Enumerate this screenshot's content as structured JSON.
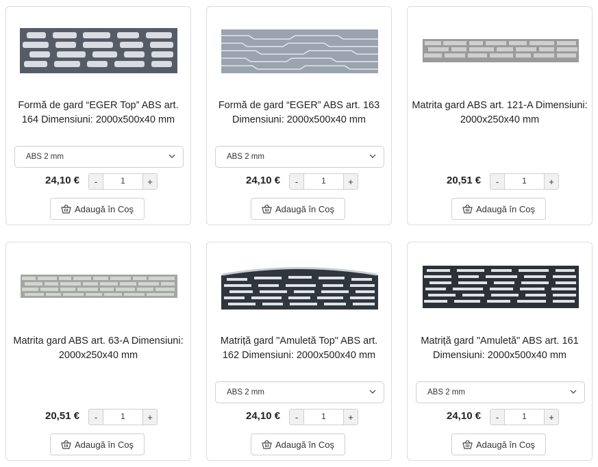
{
  "products": [
    {
      "title": "Formă de gard “EGER Top” ABS art. 164 Dimensiuni: 2000x500x40 mm",
      "variant": "ABS 2 mm",
      "price": "24,10 €",
      "qty": "1",
      "cart_label": "Adaugă în Coş",
      "image": "fence-mold-eger-top"
    },
    {
      "title": "Formă de gard “EGER” ABS art. 163 Dimensiuni: 2000x500x40 mm",
      "variant": "ABS 2 mm",
      "price": "24,10 €",
      "qty": "1",
      "cart_label": "Adaugă în Coş",
      "image": "fence-mold-eger"
    },
    {
      "title": "Matrita gard ABS art. 121-A Dimensiuni: 2000x250x40 mm",
      "variant": "",
      "price": "20,51 €",
      "qty": "1",
      "cart_label": "Adaugă în Coş",
      "image": "fence-mold-stone-121a"
    },
    {
      "title": "Matrita gard ABS art. 63-A Dimensiuni: 2000x250x40 mm",
      "variant": "",
      "price": "20,51 €",
      "qty": "1",
      "cart_label": "Adaugă în Coş",
      "image": "fence-mold-stone-63a"
    },
    {
      "title": "Matriță gard \"Amuletă Top\" ABS art. 162 Dimensiuni: 2000x500x40 mm",
      "variant": "ABS 2 mm",
      "price": "24,10 €",
      "qty": "1",
      "cart_label": "Adaugă în Coş",
      "image": "fence-mold-amuleta-top"
    },
    {
      "title": "Matriță gard \"Amuletă\" ABS art. 161 Dimensiuni: 2000x500x40 mm",
      "variant": "ABS 2 mm",
      "price": "24,10 €",
      "qty": "1",
      "cart_label": "Adaugă în Coş",
      "image": "fence-mold-amuleta"
    }
  ],
  "qty_minus": "-",
  "qty_plus": "+",
  "icons": {
    "cart": "basket-icon",
    "chevron": "chevron-down-icon"
  }
}
